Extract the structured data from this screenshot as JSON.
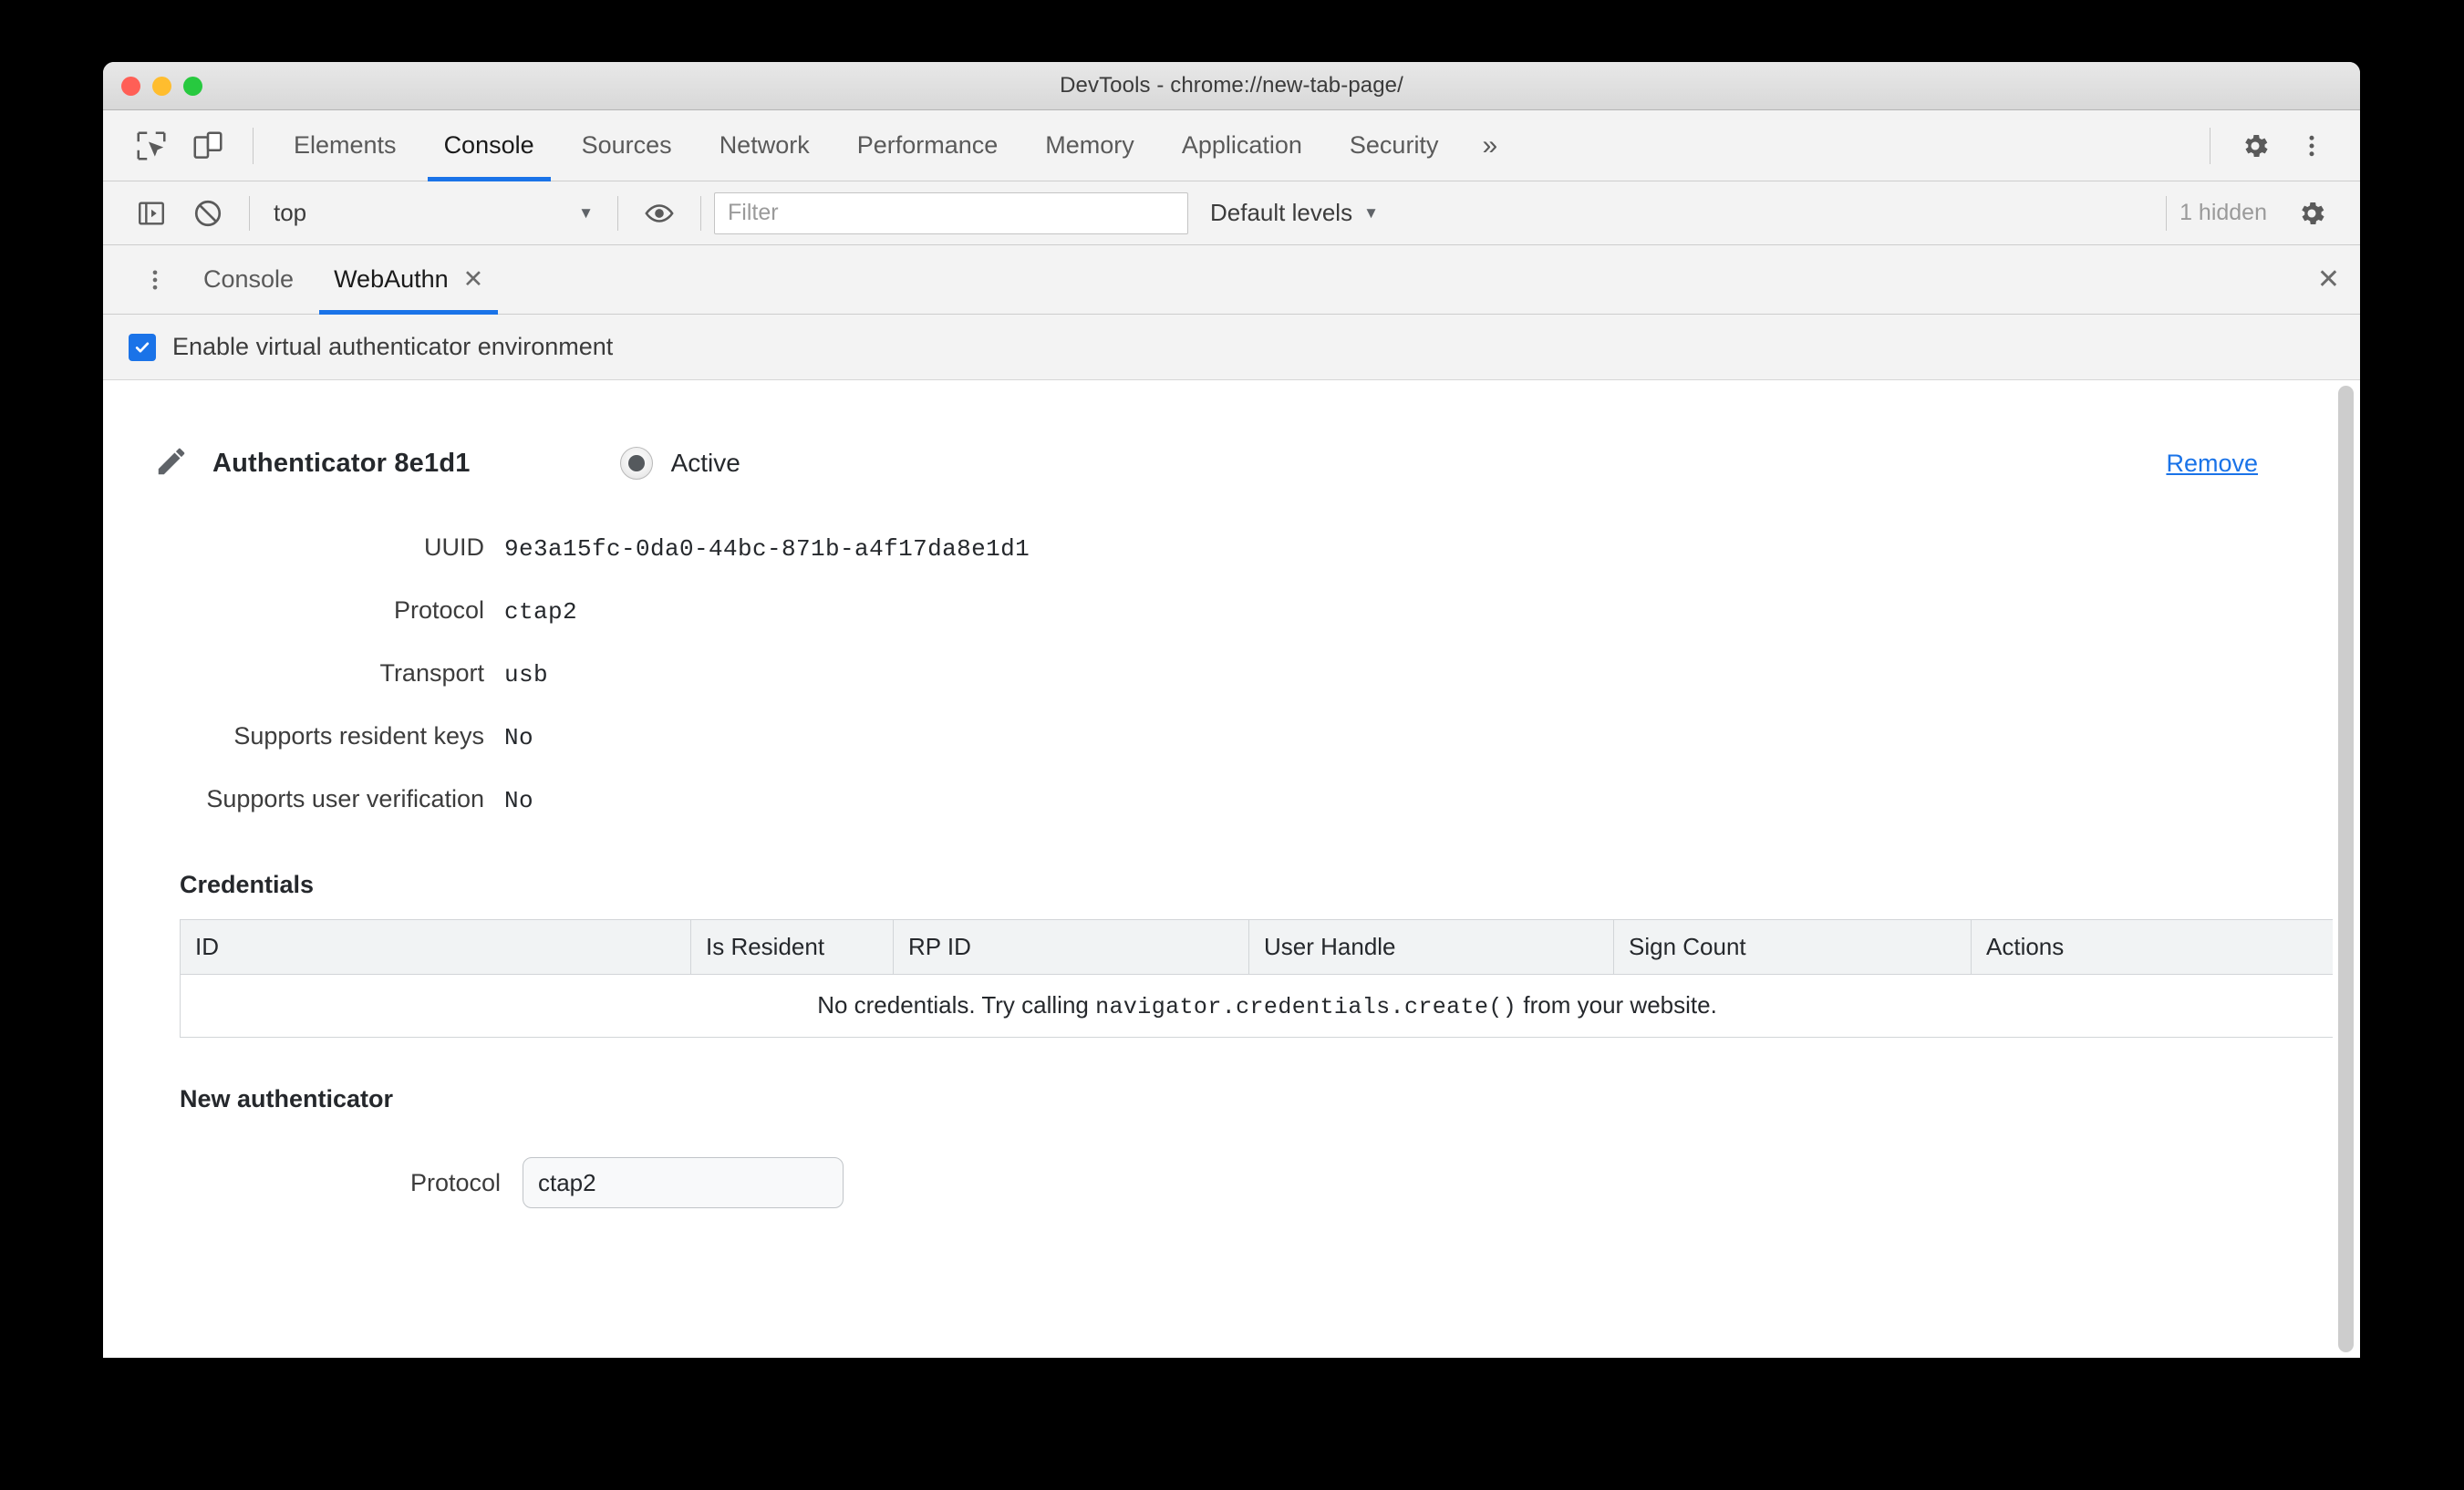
{
  "window": {
    "title": "DevTools - chrome://new-tab-page/",
    "traffic_lights": [
      "close-red",
      "minimize-yellow",
      "maximize-green"
    ]
  },
  "main_tabbar": {
    "icons": [
      "inspect-element-icon",
      "device-toolbar-icon"
    ],
    "tabs": [
      {
        "label": "Elements",
        "active": false
      },
      {
        "label": "Console",
        "active": true
      },
      {
        "label": "Sources",
        "active": false
      },
      {
        "label": "Network",
        "active": false
      },
      {
        "label": "Performance",
        "active": false
      },
      {
        "label": "Memory",
        "active": false
      },
      {
        "label": "Application",
        "active": false
      },
      {
        "label": "Security",
        "active": false
      }
    ],
    "more_label": "»",
    "right_icons": [
      "gear-icon",
      "kebab-menu-icon"
    ]
  },
  "filterbar": {
    "sidebar_toggle_icon": "console-sidebar-icon",
    "clear_icon": "clear-console-icon",
    "context": "top",
    "context_caret": "▼",
    "eye_icon": "live-expression-icon",
    "filter_placeholder": "Filter",
    "filter_value": "",
    "levels_label": "Default levels",
    "levels_caret": "▼",
    "hidden_count": "1 hidden",
    "settings_icon": "gear-icon"
  },
  "drawer": {
    "menu_icon": "kebab-menu-icon",
    "tabs": [
      {
        "label": "Console",
        "active": false,
        "closable": false
      },
      {
        "label": "WebAuthn",
        "active": true,
        "closable": true
      }
    ],
    "tab_close_glyph": "✕",
    "close_glyph": "✕"
  },
  "webauthn": {
    "enable_label": "Enable virtual authenticator environment",
    "enable_checked": true,
    "check_glyph": "✓",
    "authenticator": {
      "edit_icon": "pencil-icon",
      "name": "Authenticator 8e1d1",
      "state_label": "Active",
      "state_selected": true,
      "remove_label": "Remove",
      "fields": [
        {
          "key": "UUID",
          "value": "9e3a15fc-0da0-44bc-871b-a4f17da8e1d1"
        },
        {
          "key": "Protocol",
          "value": "ctap2"
        },
        {
          "key": "Transport",
          "value": "usb"
        },
        {
          "key": "Supports resident keys",
          "value": "No"
        },
        {
          "key": "Supports user verification",
          "value": "No"
        }
      ]
    },
    "credentials": {
      "title": "Credentials",
      "columns": [
        "ID",
        "Is Resident",
        "RP ID",
        "User Handle",
        "Sign Count",
        "Actions"
      ],
      "rows": [],
      "empty_prefix": "No credentials. Try calling ",
      "empty_code": "navigator.credentials.create()",
      "empty_suffix": " from your website."
    },
    "new_authenticator": {
      "title": "New authenticator",
      "protocol_label": "Protocol",
      "protocol_value": "ctap2"
    }
  },
  "colors": {
    "accent": "#1a73e8",
    "toolbar_bg": "#f3f3f3",
    "content_bg": "#ffffff",
    "text": "#3c3c3c",
    "muted": "#9a9a9a"
  }
}
